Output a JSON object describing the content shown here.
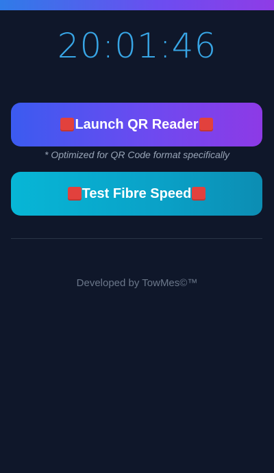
{
  "header": {
    "clock": "20:01:46"
  },
  "buttons": {
    "qr_reader_label": "Launch QR Reader",
    "fibre_speed_label": "Test Fibre Speed"
  },
  "note": "* Optimized for QR Code format specifically",
  "footer": {
    "text": "Developed by TowMes©™"
  },
  "colors": {
    "background": "#0f172a",
    "clock": "#38a6e6",
    "qr_button_gradient": [
      "#3b5bf0",
      "#8d3ae6"
    ],
    "fibre_button_gradient": [
      "#07b6d6",
      "#0c8db3"
    ],
    "emoji_square": "#e2413d"
  },
  "icons": [
    "red-square-icon"
  ]
}
